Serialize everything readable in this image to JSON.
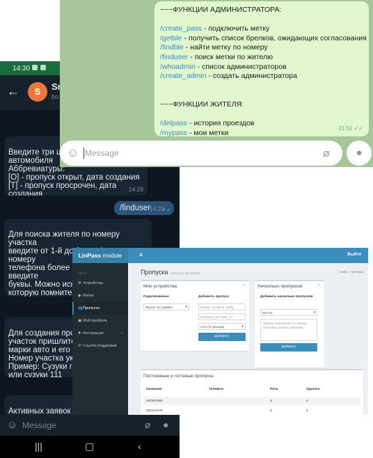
{
  "phone": {
    "status_time": "14:30",
    "chat_name": "Sn",
    "chat_sub": "bo",
    "avatar_letter": "S",
    "messages": [
      {
        "text": "Введите три ци\nавтомобиля\nАббревиатуры:\n[O] - пропуск открыт, дата создания\n[T] - пропуск просрочен, дата создания\n[X] - пропуск использован, дата проезда",
        "time": "14:29"
      },
      {
        "text": "/finduser",
        "time": "14:29"
      },
      {
        "text": "Для поиска жителя по номеру участка\nвведите от 1-й до 3-х цифр, по номеру\nтелефона более 3-х цифр, по ФИО введите\nбуквы. Можно иска\nкоторую помните\nРезультат выдачи\nЕсли не нашли нуж\nпоиск большим кол"
      },
      {
        "text": "Для создания проп\nучасток пришлите с\nмарки авто и его но\nНомер участка указ\nПример: Сузуки гра\nили сузуки 111"
      },
      {
        "text": "Активных заявок п\nнайдено"
      }
    ],
    "composer_placeholder": "Message"
  },
  "admin_chat": {
    "header": "~~~ФУНКЦИИ АДМИНИСТРАТОРА:",
    "admin_commands": [
      {
        "cmd": "/create_pass",
        "desc": " - подключить метку"
      },
      {
        "cmd": "/getble",
        "desc": " - получить список брелков, ожидающих согласования"
      },
      {
        "cmd": "/findble",
        "desc": " - найти метку по номеру"
      },
      {
        "cmd": "/finduser",
        "desc": " - поиск метки по жителю"
      },
      {
        "cmd": "/whoadmin",
        "desc": " - список администраторов"
      },
      {
        "cmd": "/create_admin",
        "desc": " - создать администратора"
      }
    ],
    "resident_header": "~~~ФУНКЦИИ ЖИТЕЛЯ:",
    "resident_commands": [
      {
        "cmd": "/delpass",
        "desc": " - история проездов"
      },
      {
        "cmd": "/mypass",
        "desc": " - мои метки"
      }
    ],
    "time": "21:51",
    "composer_placeholder": "Message"
  },
  "linpass": {
    "brand_bold": "LinPass",
    "brand_rest": " module",
    "exit_label": "Выйти",
    "menu_header": "Меню",
    "menu": [
      {
        "label": "Устройства",
        "icon": "⚙"
      },
      {
        "label": "Метки",
        "icon": "◆"
      },
      {
        "label": "Пропуска",
        "icon": "👥"
      },
      {
        "label": "Мой профиль",
        "icon": "▣"
      },
      {
        "label": "Инструкции",
        "icon": "✚"
      },
      {
        "label": "Служба поддержки",
        "icon": "✉"
      }
    ],
    "page_title": "Пропуска",
    "page_subtitle": "контроль пропусков",
    "breadcrumb": "⌂ Index › пропуска",
    "devices_box": {
      "title": "Мои устройства",
      "connected_label": "Подключенные",
      "connected_value": "Фрунзе 1Е [Админи",
      "add_label": "Добавить пропуск",
      "phone_placeholder": "Номер телефона: 8926]",
      "name_placeholder": "Название доставки, в п",
      "type_value": "гость (2 прохода)",
      "add_button": "Добавить"
    },
    "multi_box": {
      "title": "Несколько пропусков",
      "add_label": "Добавить несколько пропусков",
      "select_value": "жители",
      "textarea_placeholder": "Пример заполнения по строкам: [Телефон], пробел [описание]",
      "add_button": "Добавить"
    },
    "table_box": {
      "title": "Постоянные и гостевые пропуска",
      "columns": [
        "Название",
        "Телефон",
        "Роль",
        "Удалить"
      ],
      "rows": [
        [
          "437870305",
          "",
          "3",
          "2"
        ],
        [
          "532114475",
          "",
          "3",
          "2"
        ]
      ]
    }
  }
}
